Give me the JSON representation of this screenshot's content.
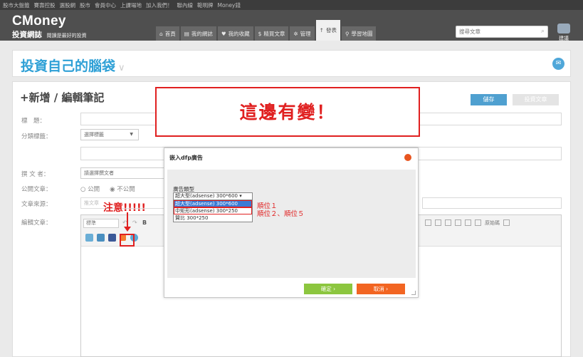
{
  "topbar": [
    "股市大盤籤",
    "賽壽控股",
    "選股網",
    "股市",
    "會員中心",
    "上課場地",
    "加入我們！",
    "聯內線",
    "範明牌",
    "Money錢"
  ],
  "brand": {
    "name": "CMoney",
    "sub": "投資網誌",
    "tagline": "閱讀是最好的投資"
  },
  "nav": [
    "首頁",
    "我的網誌",
    "我的收藏",
    "精買文章",
    "管理",
    "發表",
    "學習地圖"
  ],
  "search": {
    "placeholder": "搜尋文章"
  },
  "suggest": "建議",
  "page": {
    "title": "投資自己的腦袋"
  },
  "form": {
    "heading": "+新增 / 編輯筆記",
    "save": "儲存",
    "submit": "投資文章",
    "labels": {
      "title": "標　題：",
      "tags": "分類標籤：",
      "author": "撰 文 者：",
      "public": "公開文章：",
      "source": "文章來源：",
      "editor": "編輯文章："
    },
    "tags_value": "選擇標籤",
    "author_value": "請選擇撰文者",
    "public_opts": [
      "公開",
      "不公開"
    ],
    "source_placeholder": "推文章",
    "editor_format": "標準",
    "html_label": "原始碼"
  },
  "callout": "這邊有變！",
  "attention": "注意!!!!!",
  "dialog": {
    "title": "嵌入dfp廣告",
    "type_label": "廣告類型",
    "selected": "超大型(adsense) 300*600",
    "options": [
      "超大型(adsense) 300*600",
      "中矩形(adsense) 300*250",
      "贊比 300*250"
    ],
    "note1": "順位１",
    "note2": "順位２、順位５",
    "ok": "確定",
    "cancel": "取消"
  }
}
